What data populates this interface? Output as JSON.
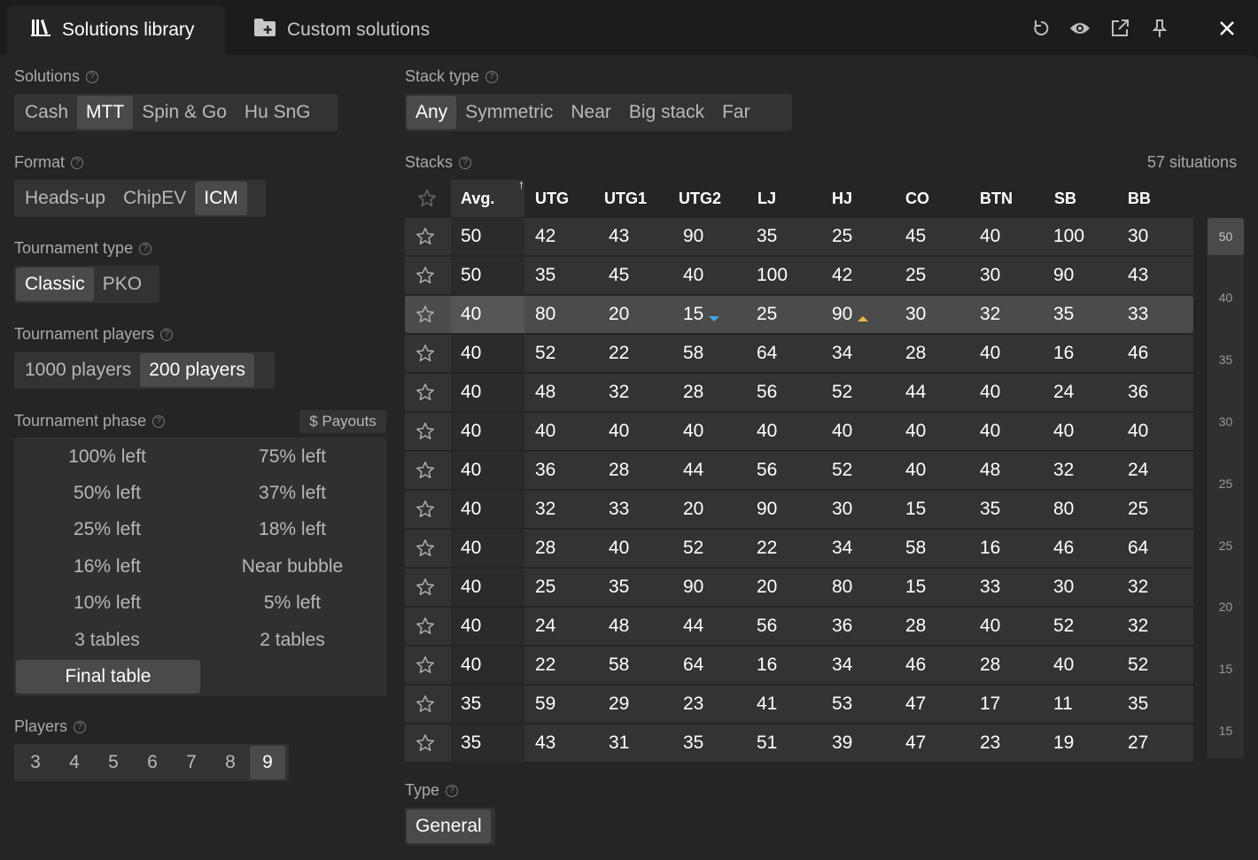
{
  "header": {
    "tabs": [
      {
        "label": "Solutions library",
        "icon": "library-icon",
        "active": true
      },
      {
        "label": "Custom solutions",
        "icon": "folder-plus-icon",
        "active": false
      }
    ],
    "actions": [
      "refresh-icon",
      "eye-icon",
      "external-link-icon",
      "pin-icon",
      "close-icon"
    ]
  },
  "solutions": {
    "label": "Solutions",
    "options": [
      "Cash",
      "MTT",
      "Spin & Go",
      "Hu SnG"
    ],
    "selected": "MTT"
  },
  "format": {
    "label": "Format",
    "options": [
      "Heads-up",
      "ChipEV",
      "ICM"
    ],
    "selected": "ICM"
  },
  "tournament_type": {
    "label": "Tournament type",
    "options": [
      "Classic",
      "PKO"
    ],
    "selected": "Classic"
  },
  "tournament_players": {
    "label": "Tournament players",
    "options": [
      "1000 players",
      "200 players"
    ],
    "selected": "200 players"
  },
  "tournament_phase": {
    "label": "Tournament phase",
    "payouts_label": "$ Payouts",
    "options": [
      "100% left",
      "75% left",
      "50% left",
      "37% left",
      "25% left",
      "18% left",
      "16% left",
      "Near bubble",
      "10% left",
      "5% left",
      "3 tables",
      "2 tables",
      "Final table"
    ],
    "selected": "Final table"
  },
  "players": {
    "label": "Players",
    "options": [
      "3",
      "4",
      "5",
      "6",
      "7",
      "8",
      "9"
    ],
    "selected": "9"
  },
  "stack_type": {
    "label": "Stack type",
    "options": [
      "Any",
      "Symmetric",
      "Near",
      "Big stack",
      "Far"
    ],
    "selected": "Any"
  },
  "stacks": {
    "label": "Stacks",
    "count_label": "57 situations",
    "columns": [
      "Avg.",
      "UTG",
      "UTG1",
      "UTG2",
      "LJ",
      "HJ",
      "CO",
      "BTN",
      "SB",
      "BB"
    ],
    "sort_indicator": "↑",
    "rows": [
      [
        "50",
        "42",
        "43",
        "90",
        "35",
        "25",
        "45",
        "40",
        "100",
        "30"
      ],
      [
        "50",
        "35",
        "45",
        "40",
        "100",
        "42",
        "25",
        "30",
        "90",
        "43"
      ],
      [
        "40",
        "80",
        "20",
        "15",
        "25",
        "90",
        "30",
        "32",
        "35",
        "33"
      ],
      [
        "40",
        "52",
        "22",
        "58",
        "64",
        "34",
        "28",
        "40",
        "16",
        "46"
      ],
      [
        "40",
        "48",
        "32",
        "28",
        "56",
        "52",
        "44",
        "40",
        "24",
        "36"
      ],
      [
        "40",
        "40",
        "40",
        "40",
        "40",
        "40",
        "40",
        "40",
        "40",
        "40"
      ],
      [
        "40",
        "36",
        "28",
        "44",
        "56",
        "52",
        "40",
        "48",
        "32",
        "24"
      ],
      [
        "40",
        "32",
        "33",
        "20",
        "90",
        "30",
        "15",
        "35",
        "80",
        "25"
      ],
      [
        "40",
        "28",
        "40",
        "52",
        "22",
        "34",
        "58",
        "16",
        "46",
        "64"
      ],
      [
        "40",
        "25",
        "35",
        "90",
        "20",
        "80",
        "15",
        "33",
        "30",
        "32"
      ],
      [
        "40",
        "24",
        "48",
        "44",
        "56",
        "36",
        "28",
        "40",
        "52",
        "32"
      ],
      [
        "40",
        "22",
        "58",
        "64",
        "16",
        "34",
        "46",
        "28",
        "40",
        "52"
      ],
      [
        "35",
        "59",
        "29",
        "23",
        "41",
        "53",
        "47",
        "17",
        "11",
        "35"
      ],
      [
        "35",
        "43",
        "31",
        "35",
        "51",
        "39",
        "47",
        "23",
        "19",
        "27"
      ]
    ],
    "selected_row": 2,
    "markers": {
      "down_color": "#3ea6e6",
      "up_color": "#e8b84a"
    },
    "scroll_labels": [
      "50",
      "40",
      "35",
      "30",
      "25",
      "25",
      "20",
      "15",
      "15"
    ]
  },
  "type": {
    "label": "Type",
    "options": [
      "General"
    ],
    "selected": "General"
  }
}
